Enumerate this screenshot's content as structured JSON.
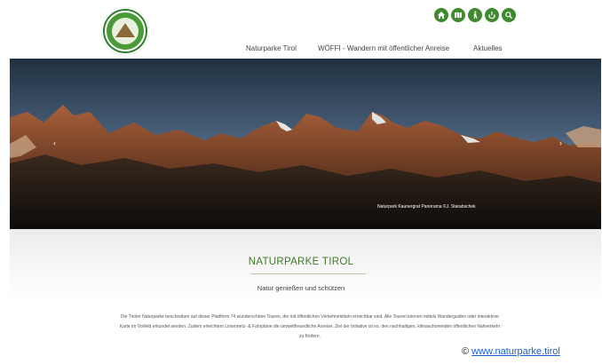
{
  "header": {
    "logo_icon": "naturparke-tirol-logo",
    "icon_buttons": [
      {
        "icon": "home-icon"
      },
      {
        "icon": "map-icon"
      },
      {
        "icon": "hiker-icon"
      },
      {
        "icon": "login-icon"
      },
      {
        "icon": "search-icon"
      }
    ],
    "accent_color": "#3f8a2e"
  },
  "nav": {
    "items": [
      {
        "label": "Naturparke Tirol"
      },
      {
        "label": "WÖFFI - Wandern mit öffentlicher Anreise"
      },
      {
        "label": "Aktuelles"
      }
    ]
  },
  "hero": {
    "caption": "Naturpark Kaunergrat Panorama ©J. Starabschek",
    "prev_arrow": "‹",
    "next_arrow": "›"
  },
  "main": {
    "title": "NATURPARKE TIROL",
    "subtitle": "Natur genießen und schützen",
    "description": "Die Tiroler Naturparke beschreiben auf dieser Plattform 74 wunderschöne Touren, die mit öffentlichen Verkehrsmitteln erreichbar sind. Alle Touren können mittels Wanderguides oder interaktiver Karte im Vorfeld erkundet werden. Zudem erleichtern Liniennetz- & Fahrpläne die umweltfreundliche Anreise. Ziel der Initiative ist es, den nachhaltigen, klimaschonenden öffentlichen Nahverkehr zu fördern."
  },
  "credit": {
    "prefix": "© ",
    "link": "www.naturparke.tirol"
  }
}
